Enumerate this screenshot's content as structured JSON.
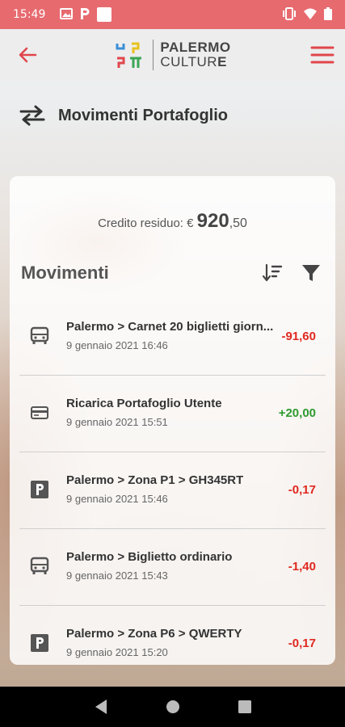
{
  "status": {
    "time": "15:49"
  },
  "header": {
    "logo_line1": "PALERMO",
    "logo_line2_main": "CULTUR",
    "logo_line2_last": "E"
  },
  "page": {
    "title": "Movimenti Portafoglio"
  },
  "wallet": {
    "credit_label": "Credito residuo: € ",
    "credit_integer": "920",
    "credit_decimal": ",50"
  },
  "movements": {
    "title": "Movimenti",
    "items": [
      {
        "icon": "bus-icon",
        "description": "Palermo > Carnet 20 biglietti giorn...",
        "date": "9 gennaio 2021 16:46",
        "amount": "-91,60",
        "type": "neg"
      },
      {
        "icon": "card-icon",
        "description": "Ricarica Portafoglio Utente",
        "date": "9 gennaio 2021 15:51",
        "amount": "+20,00",
        "type": "pos"
      },
      {
        "icon": "parking-icon",
        "description": "Palermo > Zona P1 > GH345RT",
        "date": "9 gennaio 2021 15:46",
        "amount": "-0,17",
        "type": "neg"
      },
      {
        "icon": "bus-icon",
        "description": "Palermo > Biglietto ordinario",
        "date": "9 gennaio 2021 15:43",
        "amount": "-1,40",
        "type": "neg"
      },
      {
        "icon": "parking-icon",
        "description": "Palermo > Zona P6 > QWERTY",
        "date": "9 gennaio 2021 15:20",
        "amount": "-0,17",
        "type": "neg"
      }
    ]
  },
  "colors": {
    "status_bar": "#e76a6f",
    "accent": "#e0464c",
    "negative": "#e0281f",
    "positive": "#2f9a2f"
  }
}
